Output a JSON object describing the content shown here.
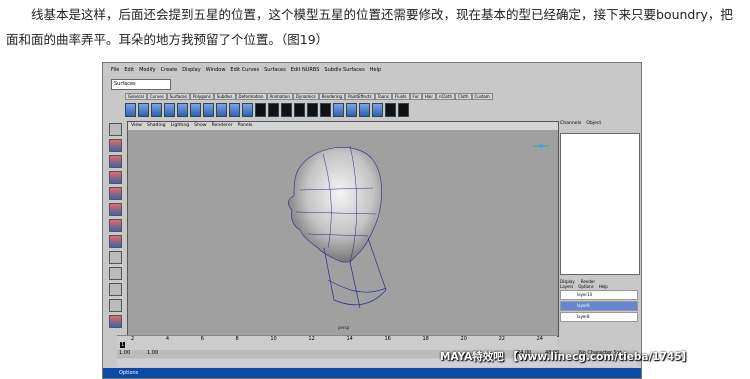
{
  "paragraph": "线基本是这样，后面还会提到五星的位置，这个模型五星的位置还需要修改，现在基本的型已经确定，接下来只要boundry，把面和面的曲率弄平。耳朵的地方我预留了个位置。（图19）",
  "figure": {
    "menubar": [
      "File",
      "Edit",
      "Modify",
      "Create",
      "Display",
      "Window",
      "Edit Curves",
      "Surfaces",
      "Edit NURBS",
      "Subdiv Surfaces",
      "Help"
    ],
    "mode_combo": "Surfaces",
    "shelf_tabs": [
      "General",
      "Curves",
      "Surfaces",
      "Polygons",
      "Subdivs",
      "Deformation",
      "Animation",
      "Dynamics",
      "Rendering",
      "PaintEffects",
      "Toons",
      "Fluids",
      "Fur",
      "Hair",
      "nCloth",
      "Cloth",
      "Custom"
    ],
    "viewport_menu": [
      "View",
      "Shading",
      "Lighting",
      "Show",
      "Renderer",
      "Panels"
    ],
    "viewport_label": "persp",
    "channel_box_tabs": [
      "Channels",
      "Object"
    ],
    "layer_mode": [
      "Display",
      "Render"
    ],
    "layer_menu": [
      "Layers",
      "Options",
      "Help"
    ],
    "layers": [
      {
        "name": "layer10",
        "selected": false
      },
      {
        "name": "layer9",
        "selected": true
      },
      {
        "name": "layer8",
        "selected": false
      }
    ],
    "timeline_ticks": [
      "2",
      "4",
      "6",
      "8",
      "10",
      "12",
      "14",
      "16",
      "18",
      "20",
      "22",
      "24"
    ],
    "current_frame": "1",
    "range": {
      "start": "1.00",
      "inner_start": "1.00",
      "end": "48.00",
      "inner_end": "24.00"
    },
    "character_set": "No Character Set",
    "taskbar_text": "Options"
  },
  "watermark": "MAYA特效吧 【www.linecg.com/tieba/1745】"
}
